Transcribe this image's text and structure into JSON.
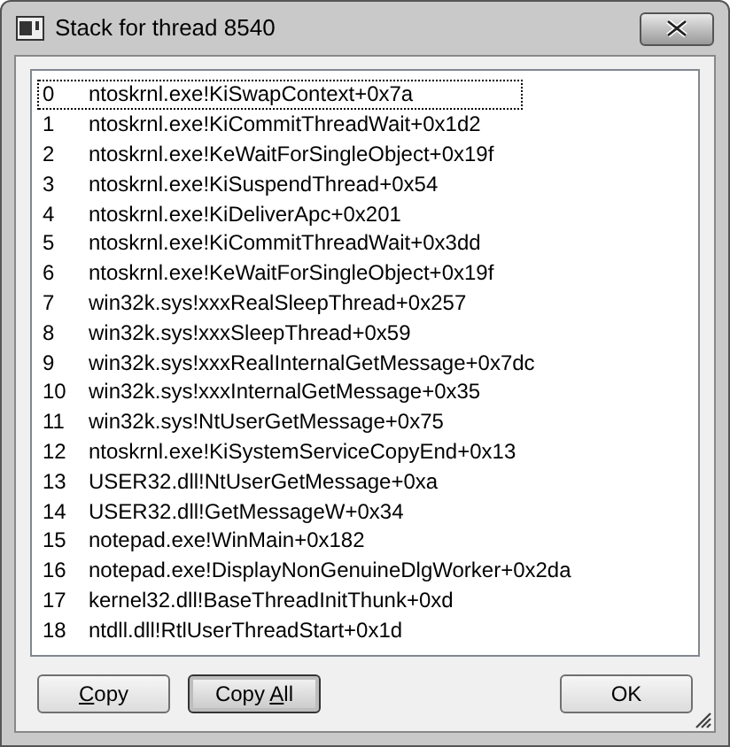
{
  "window": {
    "title": "Stack for thread 8540"
  },
  "frames": [
    {
      "index": "0",
      "name": "ntoskrnl.exe!KiSwapContext+0x7a",
      "focused": true
    },
    {
      "index": "1",
      "name": "ntoskrnl.exe!KiCommitThreadWait+0x1d2",
      "focused": false
    },
    {
      "index": "2",
      "name": "ntoskrnl.exe!KeWaitForSingleObject+0x19f",
      "focused": false
    },
    {
      "index": "3",
      "name": "ntoskrnl.exe!KiSuspendThread+0x54",
      "focused": false
    },
    {
      "index": "4",
      "name": "ntoskrnl.exe!KiDeliverApc+0x201",
      "focused": false
    },
    {
      "index": "5",
      "name": "ntoskrnl.exe!KiCommitThreadWait+0x3dd",
      "focused": false
    },
    {
      "index": "6",
      "name": "ntoskrnl.exe!KeWaitForSingleObject+0x19f",
      "focused": false
    },
    {
      "index": "7",
      "name": "win32k.sys!xxxRealSleepThread+0x257",
      "focused": false
    },
    {
      "index": "8",
      "name": "win32k.sys!xxxSleepThread+0x59",
      "focused": false
    },
    {
      "index": "9",
      "name": "win32k.sys!xxxRealInternalGetMessage+0x7dc",
      "focused": false
    },
    {
      "index": "10",
      "name": "win32k.sys!xxxInternalGetMessage+0x35",
      "focused": false
    },
    {
      "index": "11",
      "name": "win32k.sys!NtUserGetMessage+0x75",
      "focused": false
    },
    {
      "index": "12",
      "name": "ntoskrnl.exe!KiSystemServiceCopyEnd+0x13",
      "focused": false
    },
    {
      "index": "13",
      "name": "USER32.dll!NtUserGetMessage+0xa",
      "focused": false
    },
    {
      "index": "14",
      "name": "USER32.dll!GetMessageW+0x34",
      "focused": false
    },
    {
      "index": "15",
      "name": "notepad.exe!WinMain+0x182",
      "focused": false
    },
    {
      "index": "16",
      "name": "notepad.exe!DisplayNonGenuineDlgWorker+0x2da",
      "focused": false
    },
    {
      "index": "17",
      "name": "kernel32.dll!BaseThreadInitThunk+0xd",
      "focused": false
    },
    {
      "index": "18",
      "name": "ntdll.dll!RtlUserThreadStart+0x1d",
      "focused": false
    }
  ],
  "buttons": [
    {
      "key": "C",
      "after": "opy",
      "hot": false
    },
    {
      "before": "Copy ",
      "key": "A",
      "after": "ll",
      "hot": true
    }
  ],
  "ok_button": {
    "label": "OK"
  }
}
